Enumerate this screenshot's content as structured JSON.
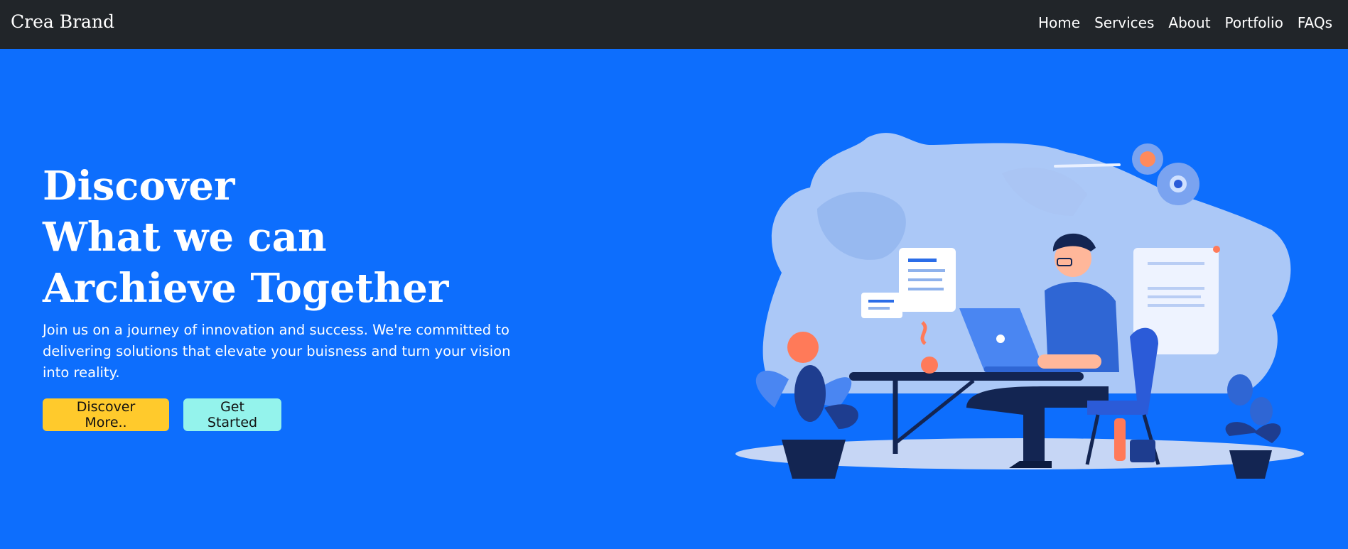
{
  "navbar": {
    "brand": "Crea Brand",
    "links": [
      "Home",
      "Services",
      "About",
      "Portfolio",
      "FAQs"
    ]
  },
  "hero": {
    "title_lines": [
      "Discover",
      "What we can",
      "Archieve Together"
    ],
    "paragraph": "Join us on a journey of innovation and success. We're committed to delivering solutions that elevate your buisness and turn your vision into reality.",
    "buttons": {
      "discover": "Discover More..",
      "start": "Get Started"
    }
  },
  "colors": {
    "navbar_bg": "#212529",
    "hero_bg": "#0d6efd",
    "discover_button": "#ffca2c",
    "start_button": "#94f3ec"
  }
}
